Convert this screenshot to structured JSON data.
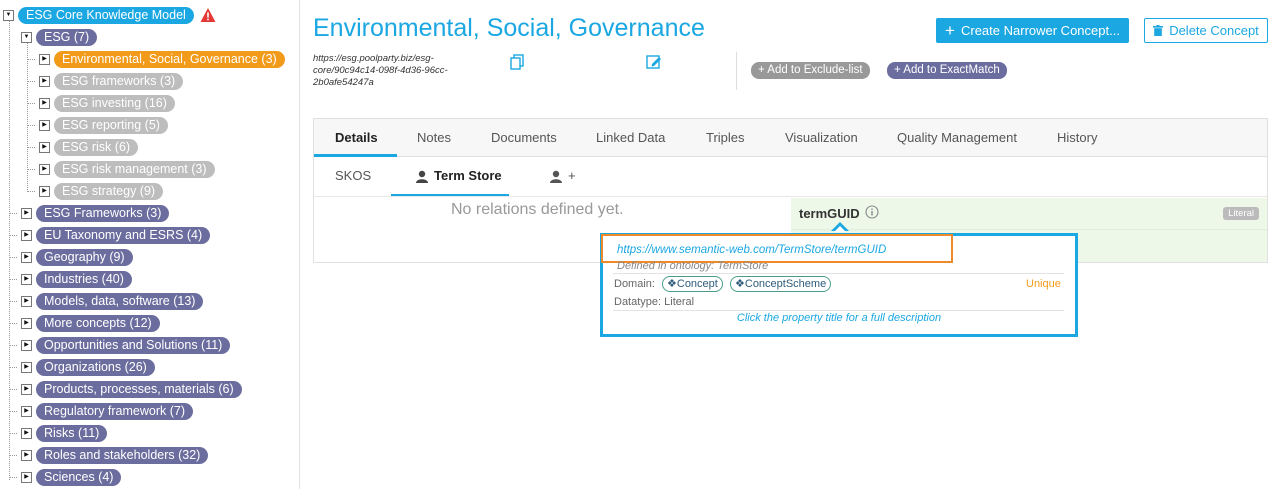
{
  "tree": {
    "root": {
      "label": "ESG Core Knowledge Model",
      "warning_icon": "warning-triangle-icon"
    },
    "esg": {
      "label": "ESG (7)"
    },
    "esg_children": [
      {
        "label": "Environmental, Social, Governance (3)",
        "state": "selected"
      },
      {
        "label": "ESG frameworks (3)"
      },
      {
        "label": "ESG investing (16)"
      },
      {
        "label": "ESG reporting (5)"
      },
      {
        "label": "ESG risk (6)"
      },
      {
        "label": "ESG risk management (3)"
      },
      {
        "label": "ESG strategy (9)"
      }
    ],
    "top_level": [
      {
        "label": "ESG Frameworks (3)"
      },
      {
        "label": "EU Taxonomy and ESRS (4)"
      },
      {
        "label": "Geography (9)"
      },
      {
        "label": "Industries (40)"
      },
      {
        "label": "Models, data, software (13)"
      },
      {
        "label": "More concepts (12)"
      },
      {
        "label": "Opportunities and Solutions (11)"
      },
      {
        "label": "Organizations (26)"
      },
      {
        "label": "Products, processes, materials (6)"
      },
      {
        "label": "Regulatory framework (7)"
      },
      {
        "label": "Risks (11)"
      },
      {
        "label": "Roles and stakeholders (32)"
      },
      {
        "label": "Sciences (4)"
      }
    ]
  },
  "concept": {
    "title": "Environmental, Social, Governance",
    "uri": "https://esg.poolparty.biz/esg-core/90c94c14-098f-4d36-96cc-2b0afe54247a"
  },
  "buttons": {
    "create_narrower": "Create Narrower Concept...",
    "delete": "Delete Concept",
    "add_exclude": "+ Add to Exclude-list",
    "add_exactmatch": "+ Add to ExactMatch"
  },
  "tabs": [
    "Details",
    "Notes",
    "Documents",
    "Linked Data",
    "Triples",
    "Visualization",
    "Quality Management",
    "History"
  ],
  "subtabs": {
    "skos": "SKOS",
    "term_store": "Term Store",
    "add": "+"
  },
  "details": {
    "no_relations": "No relations defined yet.",
    "property_name": "termGUID",
    "literal_badge": "Literal"
  },
  "tooltip": {
    "uri": "https://www.semantic-web.com/TermStore/termGUID",
    "defined_in": "Defined in ontology: TermStore",
    "domain_label": "Domain:",
    "domains": [
      "Concept",
      "ConceptScheme"
    ],
    "unique": "Unique",
    "datatype": "Datatype: Literal",
    "hint": "Click the property title for a full description"
  },
  "colors": {
    "accent": "#1aa7e2",
    "selected": "#f29a1a",
    "category": "#6b6d9e",
    "muted": "#bdbdbd",
    "highlight_box": "#ef8a2c"
  }
}
